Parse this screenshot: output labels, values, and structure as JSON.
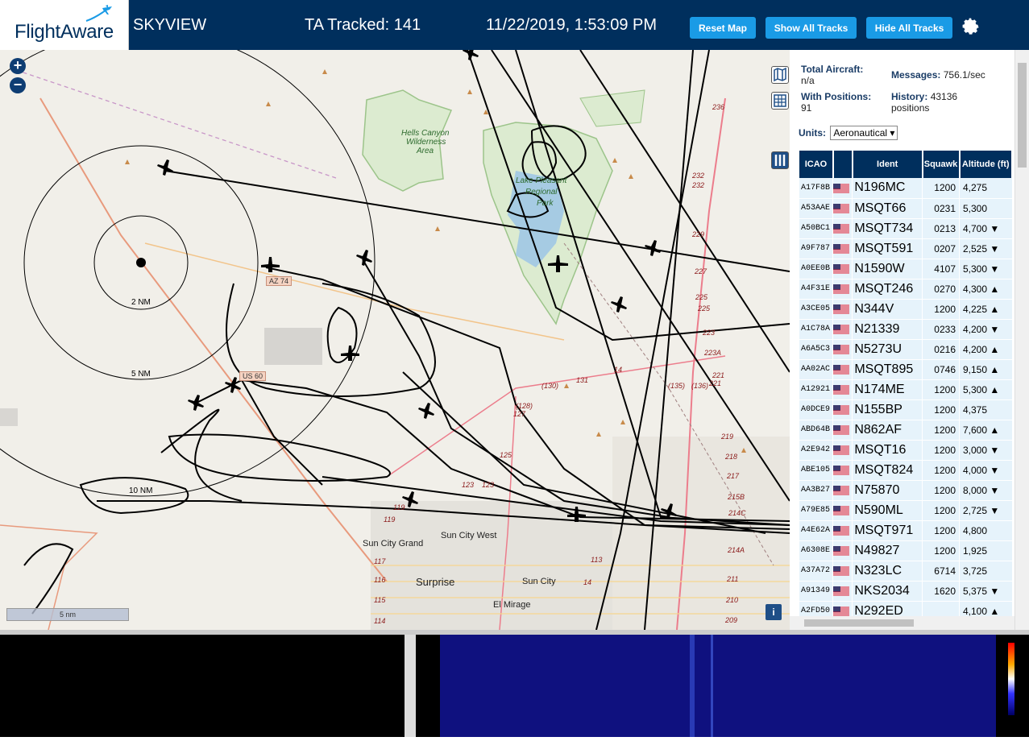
{
  "header": {
    "logo_text": "FlightAware",
    "app_title": "SKYVIEW",
    "ta_tracked": "TA Tracked: 141",
    "clock": "11/22/2019, 1:53:09 PM",
    "buttons": {
      "reset": "Reset Map",
      "show_all": "Show All Tracks",
      "hide_all": "Hide All Tracks"
    },
    "settings_icon": "gear-icon"
  },
  "map": {
    "zoom_in": "+",
    "zoom_out": "−",
    "ring_labels": [
      "2 NM",
      "5 NM",
      "10 NM"
    ],
    "places": [
      "Surprise",
      "Sun City",
      "Sun City West",
      "Sun City Grand",
      "El Mirage"
    ],
    "area_labels": [
      "Hells Canyon",
      "Wilderness",
      "Area",
      "Lake Pleasant",
      "Regional",
      "Park"
    ],
    "route_shields": [
      "AZ 74",
      "US 60"
    ],
    "highway_numbers": [
      "236",
      "232",
      "232",
      "229",
      "227",
      "225",
      "225",
      "223",
      "223A",
      "221",
      "221",
      "219",
      "218",
      "217",
      "215B",
      "214C",
      "214A",
      "211",
      "210",
      "209",
      "131",
      "(130)",
      "(128)",
      "127",
      "125",
      "123",
      "123",
      "119",
      "119",
      "117",
      "116",
      "115",
      "114",
      "113",
      "14",
      "14",
      "(135)",
      "(136)",
      "(134)"
    ],
    "scale_label": "5 nm",
    "info_button": "i",
    "controls": [
      "map-layers-icon",
      "grid-icon",
      "columns-icon"
    ]
  },
  "panel": {
    "total_aircraft_label": "Total Aircraft:",
    "total_aircraft_value": "n/a",
    "with_positions_label": "With Positions:",
    "with_positions_value": "91",
    "messages_label": "Messages:",
    "messages_value": "756.1/sec",
    "history_label": "History:",
    "history_value": "43136",
    "history_unit": "positions",
    "units_label": "Units:",
    "units_value": "Aeronautical ▾",
    "columns": [
      "ICAO",
      "",
      "Ident",
      "Squawk",
      "Altitude (ft)"
    ],
    "rows": [
      {
        "icao": "A17F8B",
        "ident": "N196MC",
        "squawk": "1200",
        "alt": "4,275"
      },
      {
        "icao": "A53AAE",
        "ident": "MSQT66",
        "squawk": "0231",
        "alt": "5,300"
      },
      {
        "icao": "A50BC1",
        "ident": "MSQT734",
        "squawk": "0213",
        "alt": "4,700 ▼"
      },
      {
        "icao": "A9F787",
        "ident": "MSQT591",
        "squawk": "0207",
        "alt": "2,525 ▼"
      },
      {
        "icao": "A0EE0B",
        "ident": "N1590W",
        "squawk": "4107",
        "alt": "5,300 ▼"
      },
      {
        "icao": "A4F31E",
        "ident": "MSQT246",
        "squawk": "0270",
        "alt": "4,300 ▲"
      },
      {
        "icao": "A3CE05",
        "ident": "N344V",
        "squawk": "1200",
        "alt": "4,225 ▲"
      },
      {
        "icao": "A1C78A",
        "ident": "N21339",
        "squawk": "0233",
        "alt": "4,200 ▼"
      },
      {
        "icao": "A6A5C3",
        "ident": "N5273U",
        "squawk": "0216",
        "alt": "4,200 ▲"
      },
      {
        "icao": "AA02AC",
        "ident": "MSQT895",
        "squawk": "0746",
        "alt": "9,150 ▲"
      },
      {
        "icao": "A12921",
        "ident": "N174ME",
        "squawk": "1200",
        "alt": "5,300 ▲"
      },
      {
        "icao": "A0DCE9",
        "ident": "N155BP",
        "squawk": "1200",
        "alt": "4,375"
      },
      {
        "icao": "ABD64B",
        "ident": "N862AF",
        "squawk": "1200",
        "alt": "7,600 ▲"
      },
      {
        "icao": "A2E942",
        "ident": "MSQT16",
        "squawk": "1200",
        "alt": "3,000 ▼"
      },
      {
        "icao": "ABE105",
        "ident": "MSQT824",
        "squawk": "1200",
        "alt": "4,000 ▼"
      },
      {
        "icao": "AA3B27",
        "ident": "N75870",
        "squawk": "1200",
        "alt": "8,000 ▼"
      },
      {
        "icao": "A79E85",
        "ident": "N590ML",
        "squawk": "1200",
        "alt": "2,725 ▼"
      },
      {
        "icao": "A4E62A",
        "ident": "MSQT971",
        "squawk": "1200",
        "alt": "4,800"
      },
      {
        "icao": "A6308E",
        "ident": "N49827",
        "squawk": "1200",
        "alt": "1,925"
      },
      {
        "icao": "A37A72",
        "ident": "N323LC",
        "squawk": "6714",
        "alt": "3,725"
      },
      {
        "icao": "A91349",
        "ident": "NKS2034",
        "squawk": "1620",
        "alt": "5,375 ▼"
      },
      {
        "icao": "A2FD50",
        "ident": "N292ED",
        "squawk": "",
        "alt": "4,100 ▲"
      }
    ]
  },
  "colors": {
    "header_bg": "#002f5d",
    "button_bg": "#1a9be6",
    "table_row_bg": "#e6f3fb",
    "map_bg": "#f1efe9"
  }
}
